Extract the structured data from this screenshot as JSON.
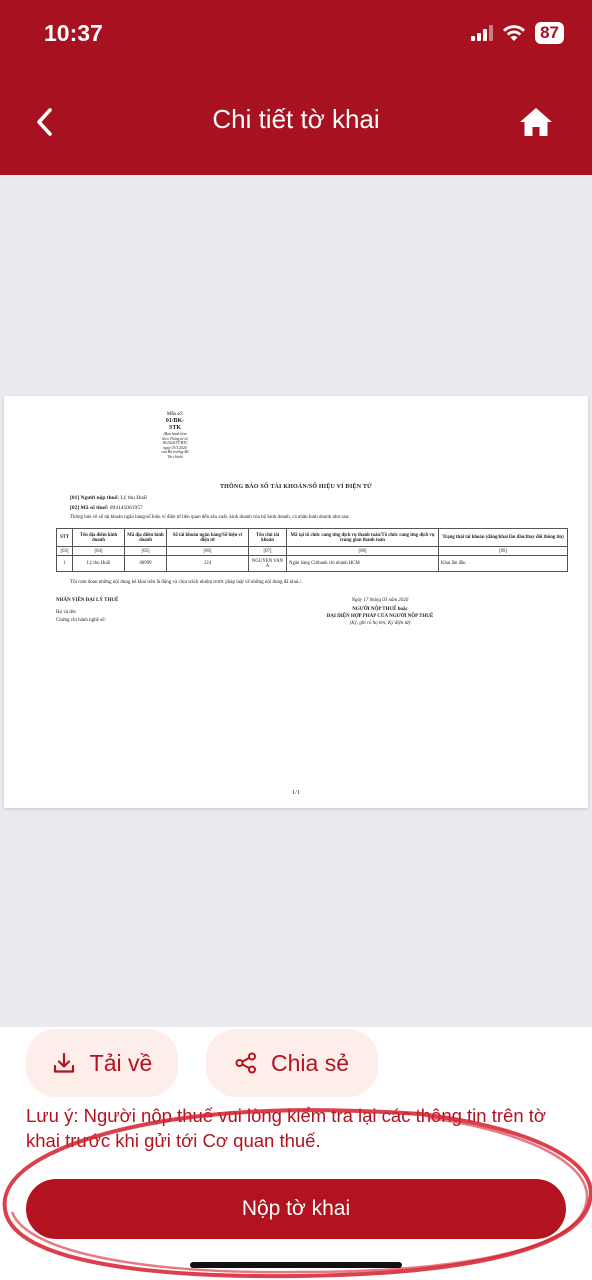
{
  "status": {
    "time": "10:37",
    "battery": "87"
  },
  "header": {
    "title": "Chi tiết tờ khai"
  },
  "document": {
    "form_label": "Mẫu số:",
    "form_code": "01/BK-STK",
    "form_note": "(Ban hành kèm theo Thông tư số 18/2026/TT-BTC ngày 03/3/2026 của Bộ trưởng Bộ Tài chính)",
    "title": "THÔNG BÁO SỐ TÀI KHOẢN/SỐ HIỆU VÍ ĐIỆN TỬ",
    "taxpayer_label": "[01] Người nộp thuế:",
    "taxpayer_name": "Lý thu Huấi",
    "taxcode_label": "[02] Mã số thuế:",
    "taxcode": "0941450619​57",
    "intro": "Thông báo về số tài khoản ngân hàng/số hiệu ví điện tử liên quan đến sản xuất, kinh doanh của hộ kinh doanh, cá nhân kinh doanh như sau:",
    "table": {
      "headers": [
        "STT",
        "Tên địa điểm kinh doanh",
        "Mã địa điểm kinh doanh",
        "Số tài khoản ngân hàng/Số hiệu ví điện tử",
        "Tên chủ tài khoản",
        "Mã tại tổ chức cung ứng dịch vụ thanh toán/Tổ chức cung ứng dịch vụ trung gian thanh toán",
        "Trạng thái tài khoản (đăng/khai lần đầu/thay đổi thông tin)"
      ],
      "codes": [
        "[03]",
        "[04]",
        "[05]",
        "[06]",
        "[07]",
        "[08]",
        "[09]"
      ],
      "rows": [
        [
          "1",
          "Lý thu Huấi",
          "00999",
          "124",
          "NGUYEN VAN A",
          "Ngân hàng Citibank chi nhánh HCM",
          "Khai lần đầu"
        ]
      ]
    },
    "commitment": "Tôi cam đoan những nội dung kê khai trên là đúng và chịu trách nhiệm trước pháp luật về những nội dung đã khai./.",
    "agent_heading": "NHÂN VIÊN ĐẠI LÝ THUẾ",
    "agent_name": "Họ và tên:",
    "agent_cert": "Chứng chỉ hành nghề số:",
    "date_line": "Ngày 17 tháng 03 năm 2026",
    "signer_1": "NGƯỜI NỘP THUẾ hoặc",
    "signer_2": "ĐẠI DIỆN HỢP PHÁP CỦA NGƯỜI NỘP THUẾ",
    "signer_3": "(Ký, ghi rõ họ tên; Ký điện tử)",
    "page_number": "1/1"
  },
  "actions": {
    "download_label": "Tải về",
    "share_label": "Chia sẻ",
    "note": "Lưu ý: Người nộp thuế vui lòng kiểm tra lại các thông tin trên tờ khai trước khi gửi tới Cơ quan thuế.",
    "submit_label": "Nộp tờ khai"
  },
  "colors": {
    "brand": "#a8111f",
    "button": "#b3121f",
    "soft": "#fdeee9"
  },
  "icons": [
    "signal-icon",
    "wifi-icon",
    "back-chevron-icon",
    "home-icon",
    "download-icon",
    "share-icon"
  ]
}
